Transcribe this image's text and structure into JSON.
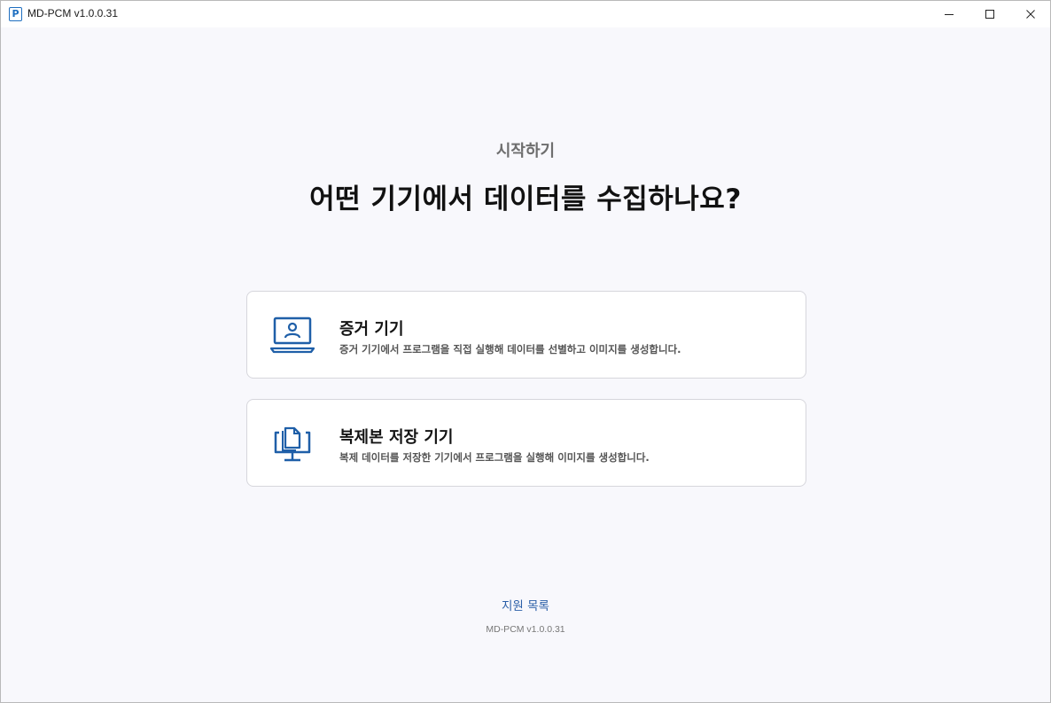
{
  "window": {
    "title": "MD-PCM v1.0.0.31",
    "app_icon_letter": "P",
    "controls": [
      "minimize-icon",
      "maximize-icon",
      "close-icon"
    ]
  },
  "main": {
    "kicker": "시작하기",
    "headline": "어떤 기기에서 데이터를 수집하나요?",
    "options": [
      {
        "icon": "laptop-user-icon",
        "title": "증거 기기",
        "description": "증거 기기에서 프로그램을 직접 실행해 데이터를 선별하고 이미지를 생성합니다."
      },
      {
        "icon": "monitor-copy-icon",
        "title": "복제본 저장 기기",
        "description": "복제 데이터를 저장한 기기에서 프로그램을 실행해 이미지를 생성합니다."
      }
    ]
  },
  "footer": {
    "support_link": "지원 목록",
    "version": "MD-PCM v1.0.0.31"
  },
  "colors": {
    "accent": "#1f5fa8",
    "background": "#f8f8fc",
    "card": "#ffffff"
  }
}
